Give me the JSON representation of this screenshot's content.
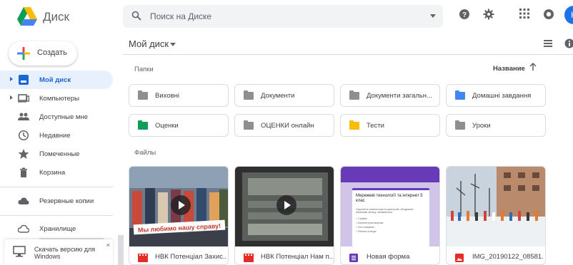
{
  "app": {
    "name": "Диск",
    "avatar_letter": "K"
  },
  "search": {
    "placeholder": "Поиск на Диске"
  },
  "sidebar": {
    "create_label": "Создать",
    "items": [
      {
        "label": "Мой диск",
        "icon": "drive-icon",
        "active": true
      },
      {
        "label": "Компьютеры",
        "icon": "computer-icon"
      },
      {
        "label": "Доступные мне",
        "icon": "people-icon"
      },
      {
        "label": "Недавние",
        "icon": "clock-icon"
      },
      {
        "label": "Помеченные",
        "icon": "star-icon"
      },
      {
        "label": "Корзина",
        "icon": "trash-icon"
      },
      {
        "label": "Резервные копии",
        "icon": "cloud-icon"
      },
      {
        "label": "Хранилище",
        "icon": "cloud-outline-icon"
      }
    ],
    "download": {
      "label": "Скачать версию для Windows",
      "close": "×"
    }
  },
  "main": {
    "breadcrumb": "Мой диск",
    "folders_title": "Папки",
    "files_title": "Файлы",
    "sort_label": "Название",
    "folders": [
      {
        "name": "Виховні",
        "color": "#8f8f8f"
      },
      {
        "name": "Документи",
        "color": "#8f8f8f"
      },
      {
        "name": "Документи загальн...",
        "color": "#8f8f8f"
      },
      {
        "name": "Домашні завдання",
        "color": "#4285f4"
      },
      {
        "name": "Оценки",
        "color": "#0f9d58"
      },
      {
        "name": "ОЦЕНКИ онлайн",
        "color": "#8f8f8f"
      },
      {
        "name": "Тести",
        "color": "#fbbc04"
      },
      {
        "name": "Уроки",
        "color": "#8f8f8f"
      }
    ],
    "files": [
      {
        "name": "НВК Потенціал Захис...",
        "type": "video"
      },
      {
        "name": "НВК Потенціал Нам п...",
        "type": "video"
      },
      {
        "name": "Новая форма",
        "type": "form"
      },
      {
        "name": "IMG_20190122_08581...",
        "type": "image"
      }
    ],
    "form_preview": {
      "title": "Мережеві технології та інтернет 5 клас",
      "question": "Сукупність комп'ютерів та пристроїв, об'єднаних каналами зв'язку, називається:",
      "options": [
        "Сервер",
        "Комп'ютерна мережа",
        "Хост-машина",
        "Робоча станція"
      ]
    },
    "video1_caption": "Мы любимо нашу справу!"
  },
  "colors": {
    "accent": "#1a73e8",
    "active_bg": "#e8f0fe",
    "form_purple": "#673ab7",
    "video_red": "#e52d27"
  }
}
